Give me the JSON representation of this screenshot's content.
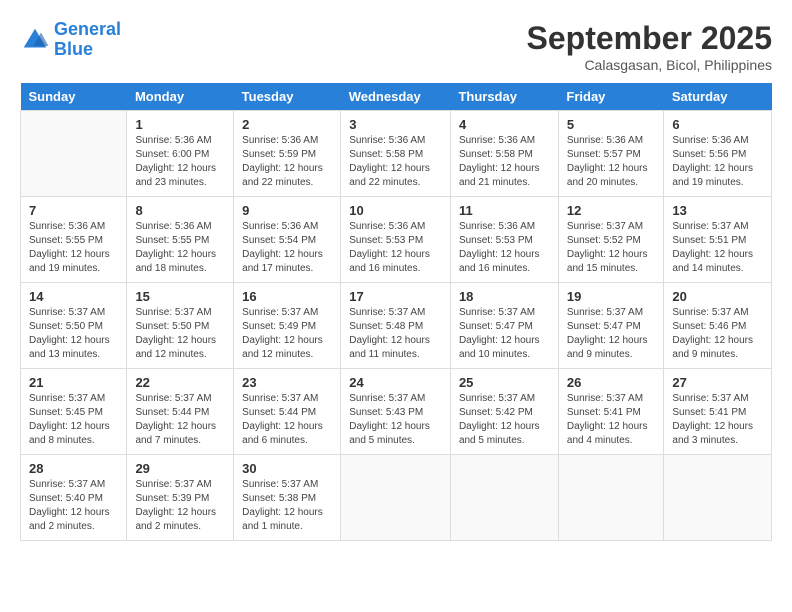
{
  "logo": {
    "line1": "General",
    "line2": "Blue"
  },
  "title": "September 2025",
  "subtitle": "Calasgasan, Bicol, Philippines",
  "weekdays": [
    "Sunday",
    "Monday",
    "Tuesday",
    "Wednesday",
    "Thursday",
    "Friday",
    "Saturday"
  ],
  "weeks": [
    [
      {
        "day": "",
        "info": ""
      },
      {
        "day": "1",
        "info": "Sunrise: 5:36 AM\nSunset: 6:00 PM\nDaylight: 12 hours\nand 23 minutes."
      },
      {
        "day": "2",
        "info": "Sunrise: 5:36 AM\nSunset: 5:59 PM\nDaylight: 12 hours\nand 22 minutes."
      },
      {
        "day": "3",
        "info": "Sunrise: 5:36 AM\nSunset: 5:58 PM\nDaylight: 12 hours\nand 22 minutes."
      },
      {
        "day": "4",
        "info": "Sunrise: 5:36 AM\nSunset: 5:58 PM\nDaylight: 12 hours\nand 21 minutes."
      },
      {
        "day": "5",
        "info": "Sunrise: 5:36 AM\nSunset: 5:57 PM\nDaylight: 12 hours\nand 20 minutes."
      },
      {
        "day": "6",
        "info": "Sunrise: 5:36 AM\nSunset: 5:56 PM\nDaylight: 12 hours\nand 19 minutes."
      }
    ],
    [
      {
        "day": "7",
        "info": "Sunrise: 5:36 AM\nSunset: 5:55 PM\nDaylight: 12 hours\nand 19 minutes."
      },
      {
        "day": "8",
        "info": "Sunrise: 5:36 AM\nSunset: 5:55 PM\nDaylight: 12 hours\nand 18 minutes."
      },
      {
        "day": "9",
        "info": "Sunrise: 5:36 AM\nSunset: 5:54 PM\nDaylight: 12 hours\nand 17 minutes."
      },
      {
        "day": "10",
        "info": "Sunrise: 5:36 AM\nSunset: 5:53 PM\nDaylight: 12 hours\nand 16 minutes."
      },
      {
        "day": "11",
        "info": "Sunrise: 5:36 AM\nSunset: 5:53 PM\nDaylight: 12 hours\nand 16 minutes."
      },
      {
        "day": "12",
        "info": "Sunrise: 5:37 AM\nSunset: 5:52 PM\nDaylight: 12 hours\nand 15 minutes."
      },
      {
        "day": "13",
        "info": "Sunrise: 5:37 AM\nSunset: 5:51 PM\nDaylight: 12 hours\nand 14 minutes."
      }
    ],
    [
      {
        "day": "14",
        "info": "Sunrise: 5:37 AM\nSunset: 5:50 PM\nDaylight: 12 hours\nand 13 minutes."
      },
      {
        "day": "15",
        "info": "Sunrise: 5:37 AM\nSunset: 5:50 PM\nDaylight: 12 hours\nand 12 minutes."
      },
      {
        "day": "16",
        "info": "Sunrise: 5:37 AM\nSunset: 5:49 PM\nDaylight: 12 hours\nand 12 minutes."
      },
      {
        "day": "17",
        "info": "Sunrise: 5:37 AM\nSunset: 5:48 PM\nDaylight: 12 hours\nand 11 minutes."
      },
      {
        "day": "18",
        "info": "Sunrise: 5:37 AM\nSunset: 5:47 PM\nDaylight: 12 hours\nand 10 minutes."
      },
      {
        "day": "19",
        "info": "Sunrise: 5:37 AM\nSunset: 5:47 PM\nDaylight: 12 hours\nand 9 minutes."
      },
      {
        "day": "20",
        "info": "Sunrise: 5:37 AM\nSunset: 5:46 PM\nDaylight: 12 hours\nand 9 minutes."
      }
    ],
    [
      {
        "day": "21",
        "info": "Sunrise: 5:37 AM\nSunset: 5:45 PM\nDaylight: 12 hours\nand 8 minutes."
      },
      {
        "day": "22",
        "info": "Sunrise: 5:37 AM\nSunset: 5:44 PM\nDaylight: 12 hours\nand 7 minutes."
      },
      {
        "day": "23",
        "info": "Sunrise: 5:37 AM\nSunset: 5:44 PM\nDaylight: 12 hours\nand 6 minutes."
      },
      {
        "day": "24",
        "info": "Sunrise: 5:37 AM\nSunset: 5:43 PM\nDaylight: 12 hours\nand 5 minutes."
      },
      {
        "day": "25",
        "info": "Sunrise: 5:37 AM\nSunset: 5:42 PM\nDaylight: 12 hours\nand 5 minutes."
      },
      {
        "day": "26",
        "info": "Sunrise: 5:37 AM\nSunset: 5:41 PM\nDaylight: 12 hours\nand 4 minutes."
      },
      {
        "day": "27",
        "info": "Sunrise: 5:37 AM\nSunset: 5:41 PM\nDaylight: 12 hours\nand 3 minutes."
      }
    ],
    [
      {
        "day": "28",
        "info": "Sunrise: 5:37 AM\nSunset: 5:40 PM\nDaylight: 12 hours\nand 2 minutes."
      },
      {
        "day": "29",
        "info": "Sunrise: 5:37 AM\nSunset: 5:39 PM\nDaylight: 12 hours\nand 2 minutes."
      },
      {
        "day": "30",
        "info": "Sunrise: 5:37 AM\nSunset: 5:38 PM\nDaylight: 12 hours\nand 1 minute."
      },
      {
        "day": "",
        "info": ""
      },
      {
        "day": "",
        "info": ""
      },
      {
        "day": "",
        "info": ""
      },
      {
        "day": "",
        "info": ""
      }
    ]
  ]
}
